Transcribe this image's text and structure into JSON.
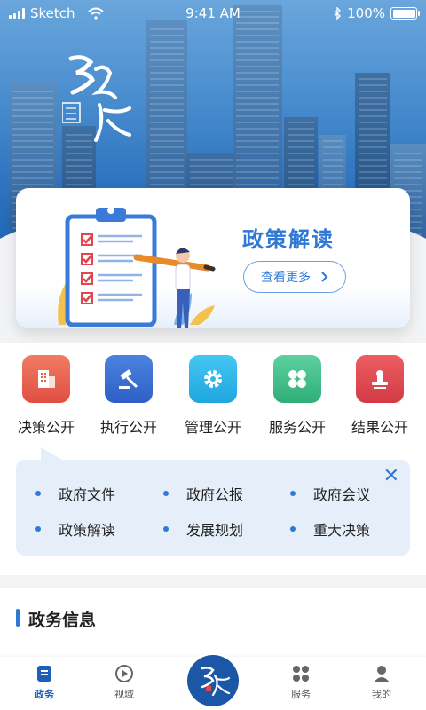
{
  "status_bar": {
    "carrier": "Sketch",
    "time": "9:41 AM",
    "battery": "100%"
  },
  "policy_card": {
    "title": "政策解读",
    "more_label": "查看更多"
  },
  "menu": [
    {
      "label": "决策公开",
      "color": "#e85d4c",
      "icon": "building-icon"
    },
    {
      "label": "执行公开",
      "color": "#3c6fd0",
      "icon": "gavel-icon"
    },
    {
      "label": "管理公开",
      "color": "#2fb6ea",
      "icon": "gear-icon"
    },
    {
      "label": "服务公开",
      "color": "#3bbf8a",
      "icon": "clover-icon"
    },
    {
      "label": "结果公开",
      "color": "#e0474f",
      "icon": "stamp-icon"
    }
  ],
  "sub_menu": [
    "政府文件",
    "政府公报",
    "政府会议",
    "政策解读",
    "发展规划",
    "重大决策"
  ],
  "section": {
    "title": "政务信息"
  },
  "tabbar": [
    {
      "label": "政务",
      "icon": "document-icon",
      "active": true
    },
    {
      "label": "视域",
      "icon": "play-icon",
      "active": false
    },
    {
      "label": "服务",
      "icon": "grid-icon",
      "active": false
    },
    {
      "label": "我的",
      "icon": "user-icon",
      "active": false
    }
  ],
  "colors": {
    "accent": "#2f79d6",
    "brand_dark": "#1b57a6",
    "panel": "#e6eff9"
  }
}
